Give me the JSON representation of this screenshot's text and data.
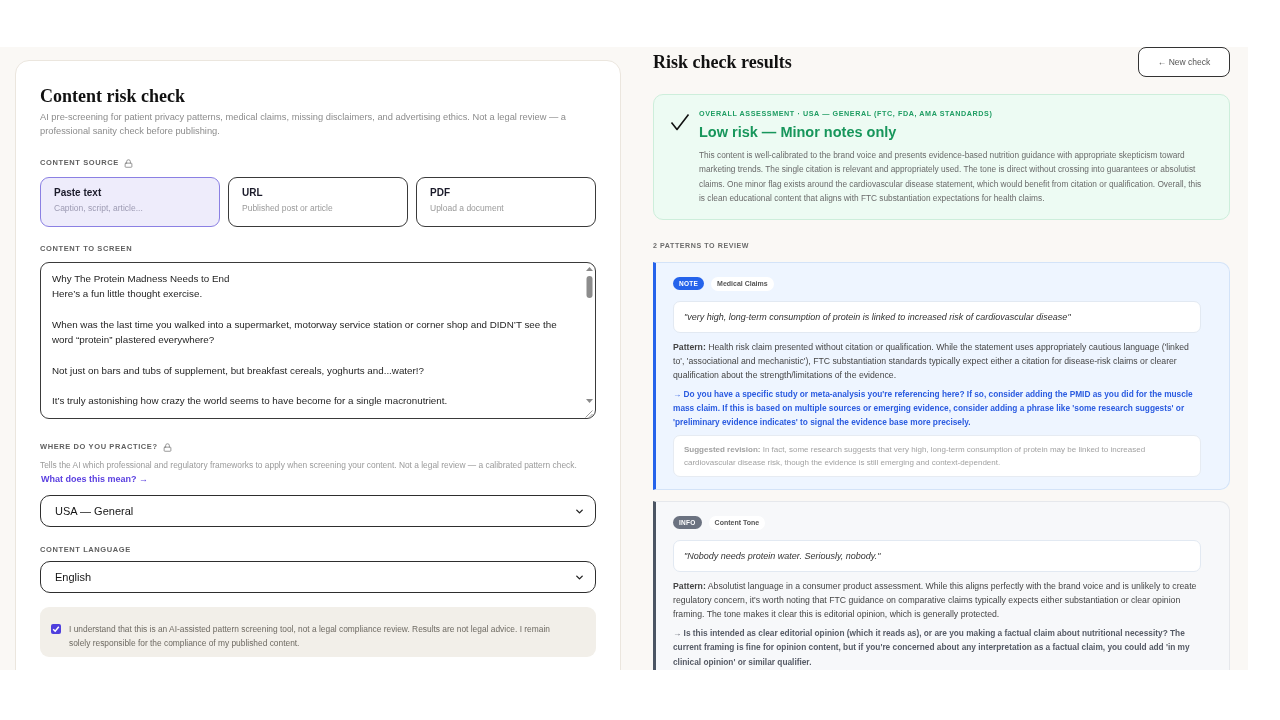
{
  "form": {
    "title": "Content risk check",
    "subtitle": "AI pre-screening for patient privacy patterns, medical claims, missing disclaimers, and advertising ethics. Not a legal review — a professional sanity check before publishing.",
    "source": {
      "label": "CONTENT SOURCE",
      "locked": true,
      "options": [
        {
          "title": "Paste text",
          "hint": "Caption, script, article...",
          "selected": true
        },
        {
          "title": "URL",
          "hint": "Published post or article",
          "selected": false
        },
        {
          "title": "PDF",
          "hint": "Upload a document",
          "selected": false
        }
      ]
    },
    "content": {
      "label": "CONTENT TO SCREEN",
      "locked": false,
      "value": "Why The Protein Madness Needs to End\nHere’s a fun little thought exercise.\n\nWhen was the last time you walked into a supermarket, motorway service station or corner shop and DIDN’T see the word “protein” plastered everywhere?\n\nNot just on bars and tubs of supplement, but breakfast cereals, yoghurts and...water!?\n\nIt’s truly astonishing how crazy the world seems to have become for a single macronutrient."
    },
    "practice": {
      "label": "WHERE DO YOU PRACTICE?",
      "locked": true,
      "description": "Tells the AI which professional and regulatory frameworks to apply when screening your content. Not a legal review — a calibrated pattern check.",
      "link": "What does this mean? →",
      "value": "USA — General"
    },
    "language": {
      "label": "CONTENT LANGUAGE",
      "locked": false,
      "value": "English"
    },
    "acknowledgement": {
      "text": "I understand that this is an AI-assisted pattern screening tool, not a legal compliance review. Results are not legal advice. I remain solely responsible for the compliance of my published content.",
      "checked": true
    }
  },
  "results": {
    "title": "Risk check results",
    "new_check_button": "← New check",
    "assessment": {
      "heading": "OVERALL ASSESSMENT · USA — GENERAL (FTC, FDA, AMA STANDARDS)",
      "verdict": "Low risk — Minor notes only",
      "summary": "This content is well-calibrated to the brand voice and presents evidence-based nutrition guidance with appropriate skepticism toward marketing trends. The single citation is relevant and appropriately used. The tone is direct without crossing into guarantees or absolutist claims. One minor flag exists around the cardiovascular disease statement, which would benefit from citation or qualification. Overall, this is clean educational content that aligns with FTC substantiation expectations for health claims."
    },
    "patterns_heading": "2 PATTERNS TO REVIEW",
    "patterns": [
      {
        "kind": "note",
        "badge": "NOTE",
        "category": "Medical Claims",
        "quote": "\"very high, long-term consumption of protein is linked to increased risk of cardiovascular disease\"",
        "pattern": "**Pattern:** Health risk claim presented without citation or qualification. While the statement uses appropriately cautious language ('linked to', 'associational and mechanistic'), FTC substantiation standards typically expect either a citation for disease-risk claims or clearer qualification about the strength/limitations of the evidence.",
        "question": "→ Do you have a specific study or meta-analysis you're referencing here? If so, consider adding the PMID as you did for the muscle mass claim. If this is based on multiple sources or emerging evidence, consider adding a phrase like 'some research suggests' or 'preliminary evidence indicates' to signal the evidence base more precisely.",
        "revision": "**Suggested revision:** In fact, some research suggests that very high, long-term consumption of protein may be linked to increased cardiovascular disease risk, though the evidence is still emerging and context-dependent."
      },
      {
        "kind": "info",
        "badge": "INFO",
        "category": "Content Tone",
        "quote": "\"Nobody needs protein water. Seriously, nobody.\"",
        "pattern": "**Pattern:** Absolutist language in a consumer product assessment. While this aligns perfectly with the brand voice and is unlikely to create regulatory concern, it's worth noting that FTC guidance on comparative claims typically expects either substantiation or clear opinion framing. The tone makes it clear this is editorial opinion, which is generally protected.",
        "question": "→ Is this intended as clear editorial opinion (which it reads as), or are you making a factual claim about nutritional necessity? The current framing is fine for opinion content, but if you're concerned about any interpretation as a factual claim, you could add 'in my clinical opinion' or similar qualifier."
      }
    ]
  }
}
